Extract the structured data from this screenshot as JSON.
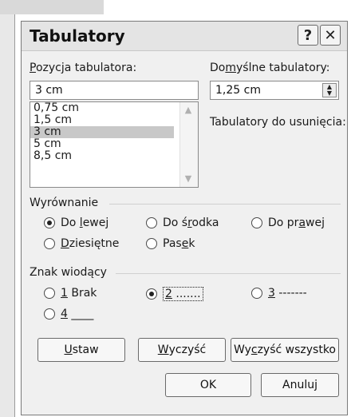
{
  "dialog": {
    "title": "Tabulatory",
    "help_glyph": "?",
    "close_glyph": "✕"
  },
  "tab_position": {
    "label_first": "P",
    "label_rest": "ozycja tabulatora:",
    "value": "3 cm",
    "items": [
      "0,75 cm",
      "1,5 cm",
      "3 cm",
      "5 cm",
      "8,5 cm"
    ],
    "selected_index": 2
  },
  "default_tabs": {
    "label_pre": "Do",
    "label_u": "m",
    "label_post": "yślne tabulatory:",
    "value": "1,25 cm"
  },
  "tabs_to_clear": {
    "label": "Tabulatory do usunięcia:"
  },
  "alignment": {
    "group_label": "Wyrównanie",
    "options": [
      {
        "pre": "Do ",
        "u": "l",
        "post": "ewej",
        "checked": true
      },
      {
        "pre": "Do ś",
        "u": "r",
        "post": "odka",
        "checked": false
      },
      {
        "pre": "Do pr",
        "u": "a",
        "post": "wej",
        "checked": false
      },
      {
        "pre": "",
        "u": "D",
        "post": "ziesiętne",
        "checked": false
      },
      {
        "pre": "Pas",
        "u": "e",
        "post": "k",
        "checked": false
      }
    ]
  },
  "leader": {
    "group_label": "Znak wiodący",
    "options": [
      {
        "u": "1",
        "post": " Brak",
        "checked": false
      },
      {
        "u": "2",
        "post": " .......",
        "checked": true
      },
      {
        "u": "3",
        "post": " -------",
        "checked": false
      },
      {
        "u": "4",
        "post": " ____",
        "checked": false
      }
    ]
  },
  "buttons": {
    "set": {
      "u": "U",
      "post": "staw"
    },
    "clear": {
      "u": "W",
      "post": "yczyść"
    },
    "clear_all": {
      "pre": "Wy",
      "u": "c",
      "post": "zyść wszystko"
    },
    "ok": "OK",
    "cancel": "Anuluj"
  }
}
